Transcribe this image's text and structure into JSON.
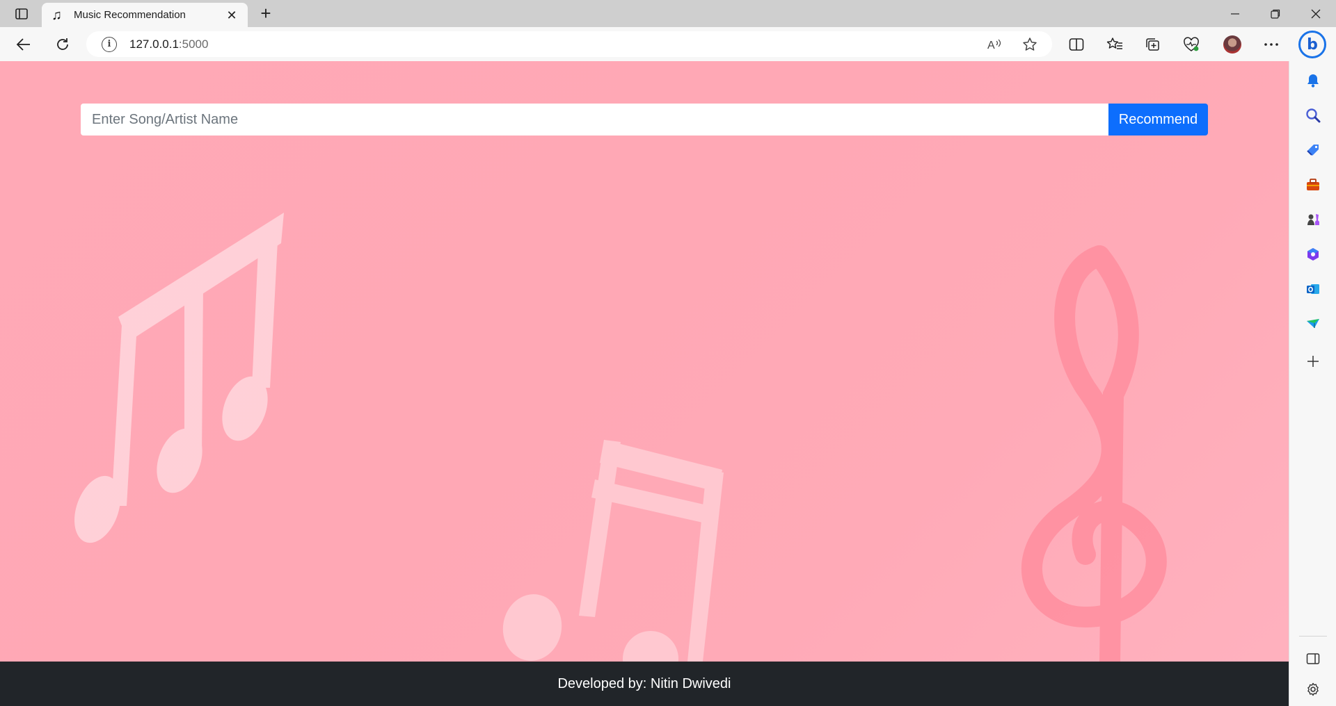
{
  "browser": {
    "tab": {
      "title": "Music Recommendation",
      "icon": "music-note-icon"
    },
    "address": {
      "host": "127.0.0.1",
      "port": ":5000"
    }
  },
  "page": {
    "search": {
      "placeholder": "Enter Song/Artist Name",
      "value": ""
    },
    "recommend_button": "Recommend",
    "footer": "Developed by: Nitin Dwivedi",
    "background_color": "#ffa9b6",
    "button_color": "#0d6efd",
    "footer_color": "#212529"
  },
  "sidebar": {
    "items": [
      "bell-icon",
      "search-icon",
      "shopping-tag-icon",
      "tools-icon",
      "games-icon",
      "microsoft365-icon",
      "outlook-icon",
      "drop-icon",
      "add-icon",
      "split-screen-icon",
      "settings-icon"
    ]
  }
}
